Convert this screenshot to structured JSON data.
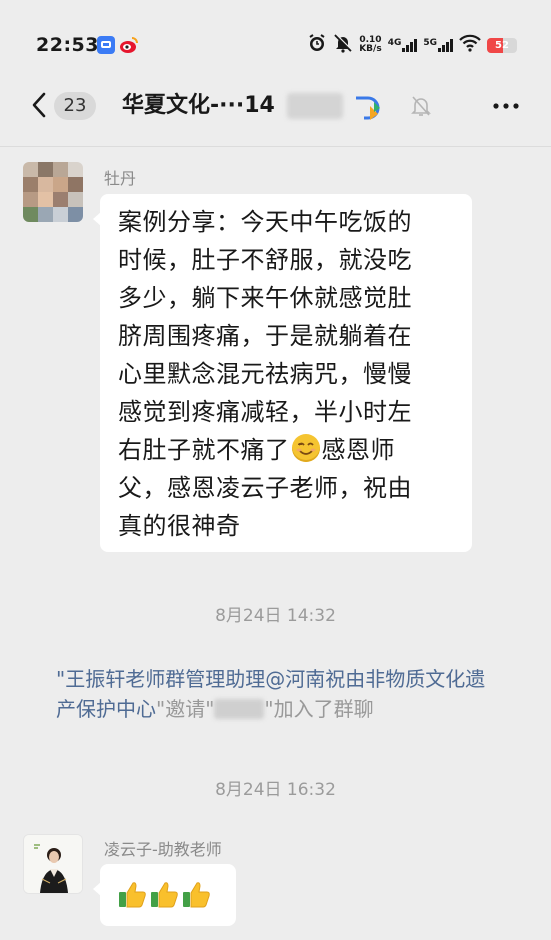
{
  "status_bar": {
    "time": "22:53",
    "speed_value": "0.10",
    "speed_unit": "KB/s",
    "net1": "4G",
    "net2": "5G",
    "battery": "52",
    "battery_level": 0.52,
    "icons": [
      "qq-icon",
      "weibo-icon",
      "alarm-icon",
      "mute-icon",
      "signal-icon",
      "wifi-icon",
      "battery-icon"
    ]
  },
  "header": {
    "unread_count": "23",
    "title": "华夏文化-···14",
    "icons": [
      "back-icon",
      "group-tag-icon",
      "mute-bell-icon",
      "more-icon"
    ]
  },
  "messages": [
    {
      "sender": "牡丹",
      "line1": "案例分享：今天中午吃饭的",
      "line2": "时候，肚子不舒服，就没吃",
      "line3": "多少，躺下来午休就感觉肚",
      "line4": "脐周围疼痛，于是就躺着在",
      "line5": "心里默念混元祛病咒，慢慢",
      "line6": "感觉到疼痛减轻，半小时左",
      "line7a": "右肚子就不痛了",
      "line7b": "感恩师",
      "line8": "父，感恩凌云子老师，祝由",
      "line9": "真的很神奇"
    },
    {
      "sender": "凌云子-助教老师",
      "content_icons": [
        "thumbs-up-icon",
        "thumbs-up-icon",
        "thumbs-up-icon"
      ]
    }
  ],
  "timestamps": {
    "t1": "8月24日 14:32",
    "t2": "8月24日 16:32"
  },
  "system_message": {
    "quote_open": "\"",
    "inviter": "王振轩老师群管理助理@河南祝由非物质文化遗产保护中心",
    "middle": "\"邀请\"",
    "end": "\"加入了群聊"
  },
  "colors": {
    "background": "#ededed",
    "bubble": "#ffffff",
    "link": "#4f6b94",
    "battery": "#f04747"
  }
}
